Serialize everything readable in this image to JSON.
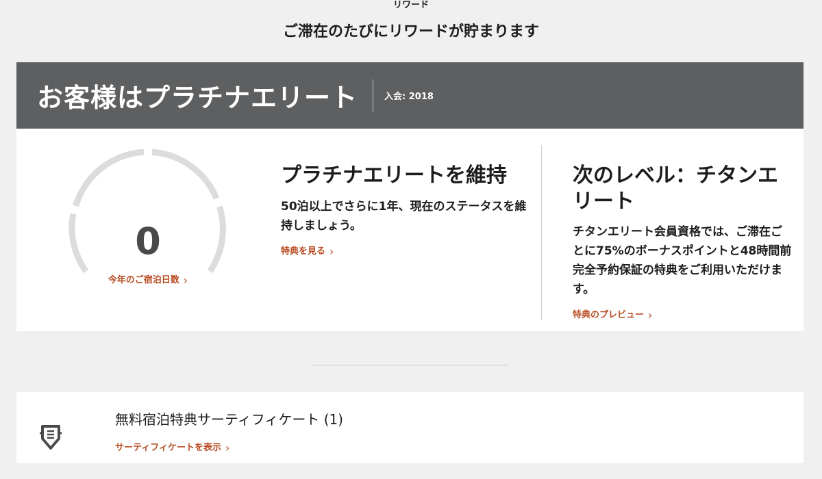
{
  "header": {
    "eyebrow": "リワード",
    "title": "ご滞在のたびにリワードが貯まります"
  },
  "tier": {
    "title": "お客様はプラチナエリート",
    "member_since": "入会: 2018"
  },
  "gauge": {
    "value": "0",
    "label": "今年のご宿泊日数",
    "progress": 0
  },
  "maintain": {
    "heading": "プラチナエリートを維持",
    "body": "50泊以上でさらに1年、現在のステータスを維持しましょう。",
    "link": "特典を見る"
  },
  "next_level": {
    "heading": "次のレベル：チタンエリート",
    "body": "チタンエリート会員資格では、ご滞在ごとに75%のボーナスポイントと48時間前完全予約保証の特典をご利用いただけます。",
    "link": "特典のプレビュー"
  },
  "certificate": {
    "title": "無料宿泊特典サーティフィケート (1)",
    "link": "サーティフィケートを表示"
  },
  "colors": {
    "accent": "#b84c23",
    "banner": "#5e5f61",
    "gauge_track": "#dcdcdc"
  },
  "icons": {
    "chevron": "chevron-right-icon",
    "certificate": "certificate-badge-icon"
  }
}
